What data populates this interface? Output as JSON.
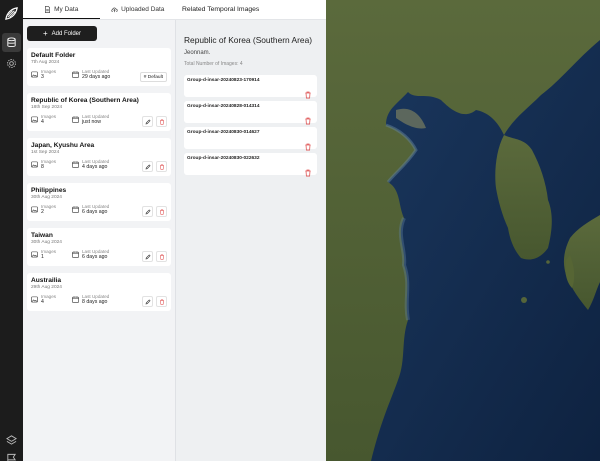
{
  "tabs": {
    "my_data": "My Data",
    "uploaded_data": "Uploaded Data"
  },
  "add_folder_label": "Add Folder",
  "stat_labels": {
    "images": "Images",
    "last_updated": "Last Updated"
  },
  "folders": [
    {
      "title": "Default Folder",
      "date": "7th Aug 2024",
      "images": "3",
      "updated": "29 days ago",
      "badge": "# Default"
    },
    {
      "title": "Republic of Korea (Southern Area)",
      "date": "18th Sep 2024",
      "images": "4",
      "updated": "just now"
    },
    {
      "title": "Japan, Kyushu Area",
      "date": "1st Sep 2024",
      "images": "8",
      "updated": "4 days ago"
    },
    {
      "title": "Philippines",
      "date": "30th Aug 2024",
      "images": "2",
      "updated": "6 days ago"
    },
    {
      "title": "Taiwan",
      "date": "30th Aug 2024",
      "images": "1",
      "updated": "6 days ago"
    },
    {
      "title": "Austrailia",
      "date": "29th Aug 2024",
      "images": "4",
      "updated": "8 days ago"
    }
  ],
  "related": {
    "header": "Related Temporal Images",
    "title": "Republic of Korea (Southern Area)",
    "subtitle": "Jeonnam.",
    "count_label": "Total Number of Images: 4",
    "groups": [
      "Group-d-insar-20240823-170914",
      "Group-d-insar-20240828-014314",
      "Group-d-insar-20240830-014627",
      "Group-d-insar-20240830-022632"
    ]
  },
  "colors": {
    "rail": "#1c1c1c",
    "accent_dark": "#1e1e1e",
    "delete_red": "#e05a5a",
    "panel_bg": "#f2f3f5"
  },
  "icons": {
    "logo": "leaf-logo-icon",
    "database": "database-icon",
    "settings": "gear-icon",
    "file": "file-icon",
    "upload": "cloud-upload-icon",
    "image": "image-icon",
    "calendar": "calendar-icon",
    "edit": "pencil-icon",
    "delete": "trash-icon",
    "close": "close-icon",
    "layers": "layers-icon",
    "flag": "flag-icon"
  }
}
